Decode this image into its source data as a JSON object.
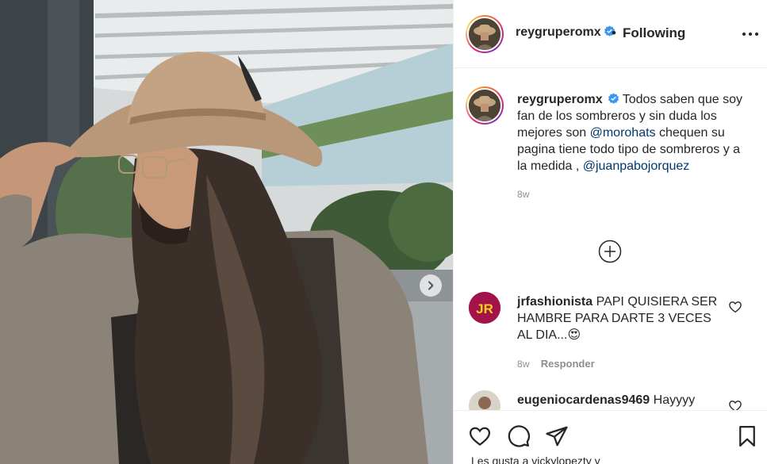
{
  "post": {
    "username": "reygruperomx",
    "follow_separator": "•",
    "follow_status": "Following",
    "caption_text": "Todos saben que soy fan de los sombreros y sin duda los mejores son",
    "caption_mention_1": "@morohats",
    "caption_text_2": "chequen su pagina tiene todo tipo de sombreros y a la medida ,",
    "caption_mention_2": "@juanpabojorquez",
    "caption_time": "8w"
  },
  "comments": [
    {
      "username": "jrfashionista",
      "avatar_initials": "JR",
      "text": "PAPI QUISIERA SER HAMBRE PARA DARTE 3 VECES AL DIA...",
      "emoji": "😍",
      "time": "8w",
      "reply_label": "Responder"
    },
    {
      "username": "eugeniocardenas9469",
      "text": "Hayyyy"
    }
  ],
  "likes_text": "Les gusta a vickylopezty y",
  "icons": {
    "verified": "verified-badge-icon",
    "more": "more-options-icon",
    "load_more": "load-more-comments-icon",
    "like": "heart-icon",
    "comment": "comment-icon",
    "share": "share-icon",
    "save": "bookmark-icon",
    "next": "chevron-right-icon"
  },
  "colors": {
    "text": "#262626",
    "mention": "#00376b",
    "secondary": "#8e8e8e",
    "verified": "#3897f0",
    "jr_avatar_bg": "#a4124a",
    "jr_avatar_text": "#f6d21c"
  }
}
